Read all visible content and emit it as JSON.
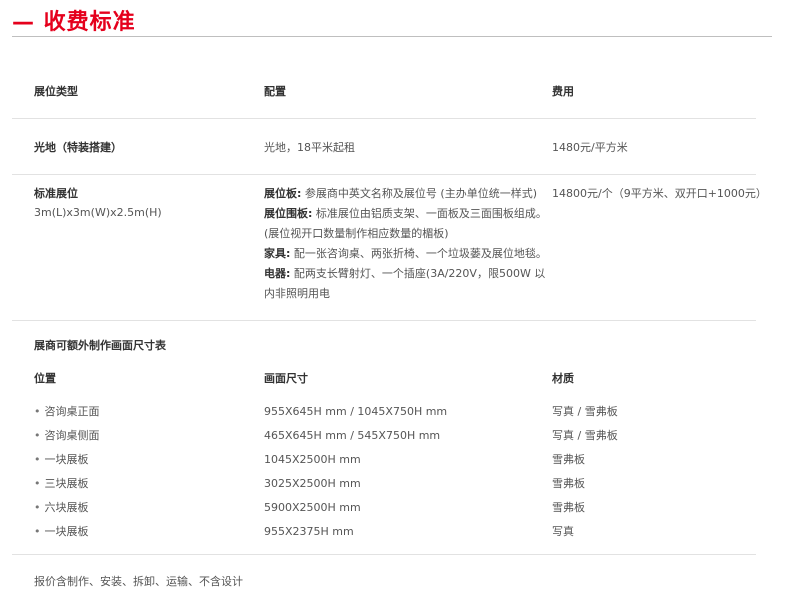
{
  "title": "— 收费标准",
  "headers": {
    "type": "展位类型",
    "config": "配置",
    "fee": "费用"
  },
  "row1": {
    "type": "光地（特装搭建）",
    "config": "光地，18平米起租",
    "fee": "1480元/平方米"
  },
  "row2": {
    "type": "标准展位",
    "type_sub": "3m(L)x3m(W)x2.5m(H)",
    "config": [
      {
        "bold": "展位板:",
        "text": " 参展商中英文名称及展位号 (主办单位统一样式)"
      },
      {
        "bold": "展位围板:",
        "text": " 标准展位由铝质支架、一面板及三面围板组成。"
      },
      {
        "bold": "",
        "text": "(展位视开口数量制作相应数量的楣板)"
      },
      {
        "bold": "家具:",
        "text": " 配一张咨询桌、两张折椅、一个垃圾蒌及展位地毯。"
      },
      {
        "bold": "电器:",
        "text": " 配两支长臂射灯、一个插座(3A/220V，限500W 以"
      },
      {
        "bold": "",
        "text": "内非照明用电"
      }
    ],
    "fee": "14800元/个（9平方米、双开口+1000元）"
  },
  "size_table": {
    "title": "展商可额外制作画面尺寸表",
    "headers": {
      "position": "位置",
      "size": "画面尺寸",
      "material": "材质"
    },
    "bullet": "•",
    "rows": [
      {
        "position": "咨询桌正面",
        "size": "955X645H mm / 1045X750H mm",
        "material": "写真 / 雪弗板"
      },
      {
        "position": "咨询桌侧面",
        "size": "465X645H mm / 545X750H mm",
        "material": "写真 / 雪弗板"
      },
      {
        "position": "一块展板",
        "size": "1045X2500H mm",
        "material": "雪弗板"
      },
      {
        "position": "三块展板",
        "size": "3025X2500H mm",
        "material": "雪弗板"
      },
      {
        "position": "六块展板",
        "size": "5900X2500H mm",
        "material": "雪弗板"
      },
      {
        "position": "一块展板",
        "size": "955X2375H mm",
        "material": "写真"
      }
    ]
  },
  "footnote": "报价含制作、安装、拆卸、运输、不含设计"
}
